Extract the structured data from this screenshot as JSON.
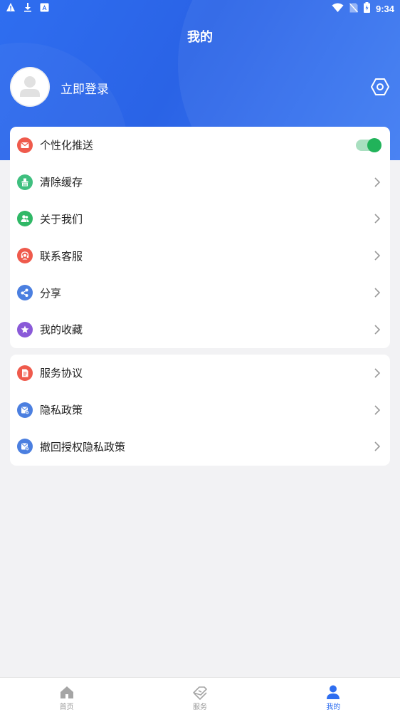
{
  "status_bar": {
    "time": "9:34"
  },
  "header": {
    "title": "我的",
    "login_text": "立即登录"
  },
  "colors": {
    "primary": "#2f6ef0",
    "toggle_on": "#21b35a"
  },
  "menu_group_1": [
    {
      "label": "个性化推送",
      "icon": "mail-icon",
      "icon_color": "#ef5a4c",
      "type": "toggle",
      "toggle_on": true
    },
    {
      "label": "清除缓存",
      "icon": "broom-icon",
      "icon_color": "#3fbf7f",
      "type": "link"
    },
    {
      "label": "关于我们",
      "icon": "people-icon",
      "icon_color": "#2fb866",
      "type": "link"
    },
    {
      "label": "联系客服",
      "icon": "headset-icon",
      "icon_color": "#ef5a4c",
      "type": "link"
    },
    {
      "label": "分享",
      "icon": "share-icon",
      "icon_color": "#4b7fe0",
      "type": "link"
    },
    {
      "label": "我的收藏",
      "icon": "star-icon",
      "icon_color": "#8a5ad8",
      "type": "link"
    }
  ],
  "menu_group_2": [
    {
      "label": "服务协议",
      "icon": "document-icon",
      "icon_color": "#ef5a4c",
      "type": "link"
    },
    {
      "label": "隐私政策",
      "icon": "privacy-icon",
      "icon_color": "#4b7fe0",
      "type": "link"
    },
    {
      "label": "撤回授权隐私政策",
      "icon": "revoke-privacy-icon",
      "icon_color": "#4b7fe0",
      "type": "link"
    }
  ],
  "bottom_nav": [
    {
      "label": "首页",
      "icon": "home-icon",
      "active": false
    },
    {
      "label": "服务",
      "icon": "service-icon",
      "active": false
    },
    {
      "label": "我的",
      "icon": "profile-icon",
      "active": true
    }
  ]
}
